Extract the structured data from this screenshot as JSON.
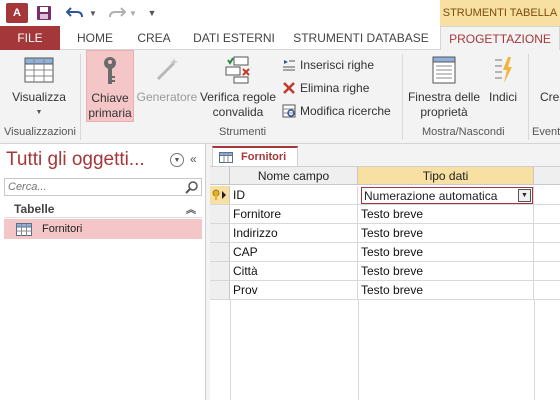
{
  "app": {
    "icon_text": "A",
    "context_tab_header": "STRUMENTI TABELLA"
  },
  "tabs": {
    "file": "FILE",
    "home": "HOME",
    "crea": "CREA",
    "dati_esterni": "DATI ESTERNI",
    "strumenti_database": "STRUMENTI DATABASE",
    "progettazione": "PROGETTAZIONE"
  },
  "ribbon": {
    "visualizza": "Visualizza",
    "chiave_line1": "Chiave",
    "chiave_line2": "primaria",
    "generatore": "Generatore",
    "verifica_line1": "Verifica regole",
    "verifica_line2": "convalida",
    "inserisci_righe": "Inserisci righe",
    "elimina_righe": "Elimina righe",
    "modifica_ricerche": "Modifica ricerche",
    "finestra_line1": "Finestra delle",
    "finestra_line2": "proprietà",
    "indici": "Indici",
    "crea_cut": "Cre",
    "groups": {
      "visualizzazioni": "Visualizzazioni",
      "strumenti": "Strumenti",
      "mostra_nascondi": "Mostra/Nascondi",
      "eventi_cut": "Eventi"
    }
  },
  "nav": {
    "title": "Tutti gli oggetti...",
    "search_placeholder": "Cerca...",
    "group_tabelle": "Tabelle",
    "items": [
      {
        "label": "Fornitori"
      }
    ]
  },
  "document": {
    "tab_label": "Fornitori",
    "columns": {
      "nome": "Nome campo",
      "tipo": "Tipo dati"
    },
    "rows": [
      {
        "nome": "ID",
        "tipo": "Numerazione automatica",
        "primary_key": true
      },
      {
        "nome": "Fornitore",
        "tipo": "Testo breve"
      },
      {
        "nome": "Indirizzo",
        "tipo": "Testo breve"
      },
      {
        "nome": "CAP",
        "tipo": "Testo breve"
      },
      {
        "nome": "Città",
        "tipo": "Testo breve"
      },
      {
        "nome": "Prov",
        "tipo": "Testo breve"
      }
    ]
  },
  "colors": {
    "access_red": "#a4373a",
    "selection_pink": "#f4c6c7",
    "highlight_yellow": "#f8dfa2"
  }
}
